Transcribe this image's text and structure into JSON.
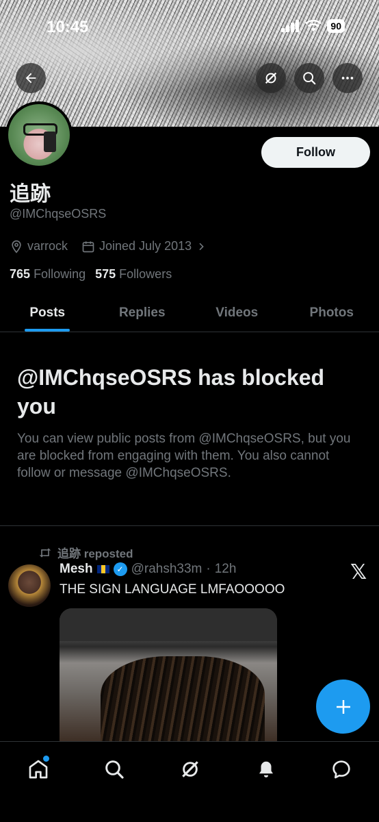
{
  "status_bar": {
    "time": "10:45",
    "battery": "90"
  },
  "profile": {
    "display_name": "追跡",
    "handle": "@IMChqseOSRS",
    "location": "varrock",
    "joined": "Joined July 2013",
    "following_count": "765",
    "following_label": "Following",
    "followers_count": "575",
    "followers_label": "Followers",
    "follow_button": "Follow"
  },
  "tabs": [
    {
      "label": "Posts",
      "active": true
    },
    {
      "label": "Replies",
      "active": false
    },
    {
      "label": "Videos",
      "active": false
    },
    {
      "label": "Photos",
      "active": false
    }
  ],
  "blocked_notice": {
    "title": "@IMChqseOSRS has blocked you",
    "description": "You can view public posts from @IMChqseOSRS, but you are blocked from engaging with them. You also cannot follow or message @IMChqseOSRS."
  },
  "post": {
    "repost_label": "追跡 reposted",
    "author_name": "Mesh",
    "author_handle": "@rahsh33m",
    "separator": "·",
    "time": "12h",
    "text": "THE SIGN LANGUAGE LMFAOOOOO"
  },
  "colors": {
    "accent": "#1d9bf0",
    "muted": "#71767b",
    "text": "#e7e9ea",
    "background": "#000000"
  }
}
